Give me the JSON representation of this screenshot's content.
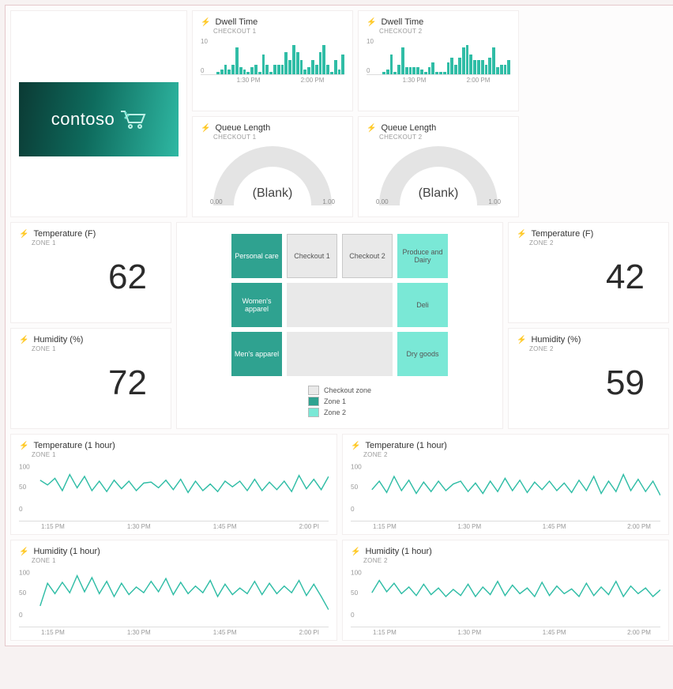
{
  "brand": {
    "name": "contoso"
  },
  "dwell": [
    {
      "title": "Dwell Time",
      "sub": "CHECKOUT 1",
      "ymax": "10",
      "ymin": "0",
      "xticks": [
        "1:30 PM",
        "2:00 PM"
      ]
    },
    {
      "title": "Dwell Time",
      "sub": "CHECKOUT 2",
      "ymax": "10",
      "ymin": "0",
      "xticks": [
        "1:30 PM",
        "2:00 PM"
      ]
    }
  ],
  "queue": [
    {
      "title": "Queue Length",
      "sub": "CHECKOUT 1",
      "value": "(Blank)",
      "min": "0.00",
      "max": "1.00"
    },
    {
      "title": "Queue Length",
      "sub": "CHECKOUT 2",
      "value": "(Blank)",
      "min": "0.00",
      "max": "1.00"
    }
  ],
  "stats": {
    "temp1": {
      "title": "Temperature (F)",
      "sub": "ZONE 1",
      "value": "62"
    },
    "hum1": {
      "title": "Humidity (%)",
      "sub": "ZONE 1",
      "value": "72"
    },
    "temp2": {
      "title": "Temperature (F)",
      "sub": "ZONE 2",
      "value": "42"
    },
    "hum2": {
      "title": "Humidity (%)",
      "sub": "ZONE 2",
      "value": "59"
    }
  },
  "zone_map": {
    "cells": [
      {
        "label": "Personal care",
        "class": "z1"
      },
      {
        "label": "Checkout 1",
        "class": "chk"
      },
      {
        "label": "Checkout 2",
        "class": "chk"
      },
      {
        "label": "Produce and Dairy",
        "class": "z2"
      },
      {
        "label": "Women's apparel",
        "class": "z1"
      },
      {
        "label": "",
        "class": "floor",
        "span": 2
      },
      {
        "label": "Deli",
        "class": "z2"
      },
      {
        "label": "Men's apparel",
        "class": "z1"
      },
      {
        "label": "",
        "class": "floor",
        "span": 2
      },
      {
        "label": "Dry goods",
        "class": "z2"
      }
    ],
    "legend": [
      {
        "label": "Checkout zone",
        "color": "#e9e9e9"
      },
      {
        "label": "Zone 1",
        "color": "#2fa290"
      },
      {
        "label": "Zone 2",
        "color": "#7ae8d6"
      }
    ]
  },
  "history": [
    {
      "title": "Temperature (1 hour)",
      "sub": "ZONE 1",
      "ymax": "100",
      "ymid": "50",
      "ymin": "0",
      "xticks": [
        "1:15 PM",
        "1:30 PM",
        "1:45 PM",
        "2:00 PI"
      ]
    },
    {
      "title": "Temperature (1 hour)",
      "sub": "ZONE 2",
      "ymax": "100",
      "ymid": "50",
      "ymin": "0",
      "xticks": [
        "1:15 PM",
        "1:30 PM",
        "1:45 PM",
        "2:00 PM"
      ]
    },
    {
      "title": "Humidity (1 hour)",
      "sub": "ZONE 1",
      "ymax": "100",
      "ymid": "50",
      "ymin": "0",
      "xticks": [
        "1:15 PM",
        "1:30 PM",
        "1:45 PM",
        "2:00 PI"
      ]
    },
    {
      "title": "Humidity (1 hour)",
      "sub": "ZONE 2",
      "ymax": "100",
      "ymid": "50",
      "ymin": "0",
      "xticks": [
        "1:15 PM",
        "1:30 PM",
        "1:45 PM",
        "2:00 PM"
      ]
    }
  ],
  "chart_data": [
    {
      "type": "bar",
      "id": "dwell_checkout_1",
      "title": "Dwell Time CHECKOUT 1",
      "ylim": [
        0,
        15
      ],
      "xticks": [
        "1:30 PM",
        "2:00 PM"
      ],
      "values": [
        1,
        2,
        4,
        2,
        4,
        11,
        3,
        2,
        1,
        3,
        4,
        1,
        8,
        4,
        1,
        4,
        4,
        4,
        9,
        6,
        12,
        9,
        6,
        2,
        3,
        6,
        4,
        9,
        12,
        4,
        1,
        6,
        2,
        8
      ]
    },
    {
      "type": "bar",
      "id": "dwell_checkout_2",
      "title": "Dwell Time CHECKOUT 2",
      "ylim": [
        0,
        15
      ],
      "xticks": [
        "1:30 PM",
        "2:00 PM"
      ],
      "values": [
        1,
        2,
        8,
        1,
        4,
        11,
        3,
        3,
        3,
        3,
        2,
        1,
        3,
        5,
        1,
        1,
        1,
        5,
        7,
        4,
        7,
        11,
        12,
        8,
        6,
        6,
        6,
        4,
        7,
        11,
        3,
        4,
        4,
        6
      ]
    },
    {
      "type": "gauge",
      "id": "queue_checkout_1",
      "title": "Queue Length CHECKOUT 1",
      "min": 0.0,
      "max": 1.0,
      "value": null,
      "display": "(Blank)"
    },
    {
      "type": "gauge",
      "id": "queue_checkout_2",
      "title": "Queue Length CHECKOUT 2",
      "min": 0.0,
      "max": 1.0,
      "value": null,
      "display": "(Blank)"
    },
    {
      "type": "line",
      "id": "temp_zone1_1h",
      "title": "Temperature (1 hour) ZONE 1",
      "ylim": [
        0,
        100
      ],
      "xticks": [
        "1:15 PM",
        "1:30 PM",
        "1:45 PM",
        "2:00 PM"
      ],
      "values": [
        62,
        52,
        66,
        40,
        74,
        46,
        70,
        40,
        60,
        38,
        62,
        44,
        60,
        40,
        56,
        58,
        46,
        62,
        42,
        64,
        36,
        60,
        40,
        54,
        38,
        60,
        48,
        60,
        40,
        64,
        40,
        58,
        42,
        60,
        38,
        72,
        44,
        64,
        42,
        70
      ]
    },
    {
      "type": "line",
      "id": "temp_zone2_1h",
      "title": "Temperature (1 hour) ZONE 2",
      "ylim": [
        0,
        100
      ],
      "xticks": [
        "1:15 PM",
        "1:30 PM",
        "1:45 PM",
        "2:00 PM"
      ],
      "values": [
        42,
        60,
        36,
        70,
        40,
        62,
        34,
        58,
        38,
        60,
        40,
        54,
        60,
        38,
        56,
        34,
        60,
        38,
        66,
        40,
        62,
        36,
        58,
        42,
        60,
        40,
        56,
        36,
        62,
        40,
        70,
        34,
        60,
        38,
        74,
        40,
        64,
        38,
        60,
        30
      ]
    },
    {
      "type": "line",
      "id": "hum_zone1_1h",
      "title": "Humidity (1 hour) ZONE 1",
      "ylim": [
        0,
        100
      ],
      "xticks": [
        "1:15 PM",
        "1:30 PM",
        "1:45 PM",
        "2:00 PM"
      ],
      "values": [
        20,
        68,
        46,
        70,
        48,
        84,
        50,
        80,
        46,
        72,
        40,
        68,
        44,
        60,
        48,
        72,
        50,
        78,
        44,
        70,
        46,
        62,
        48,
        74,
        40,
        66,
        44,
        58,
        46,
        72,
        44,
        68,
        46,
        62,
        48,
        74,
        42,
        66,
        40,
        12
      ]
    },
    {
      "type": "line",
      "id": "hum_zone2_1h",
      "title": "Humidity (1 hour) ZONE 2",
      "ylim": [
        0,
        100
      ],
      "xticks": [
        "1:15 PM",
        "1:30 PM",
        "1:45 PM",
        "2:00 PM"
      ],
      "values": [
        48,
        74,
        50,
        68,
        46,
        60,
        42,
        66,
        44,
        58,
        40,
        55,
        42,
        66,
        40,
        60,
        44,
        72,
        42,
        64,
        46,
        58,
        40,
        70,
        42,
        62,
        46,
        56,
        40,
        68,
        42,
        60,
        44,
        72,
        40,
        62,
        46,
        58,
        40,
        54
      ]
    }
  ]
}
